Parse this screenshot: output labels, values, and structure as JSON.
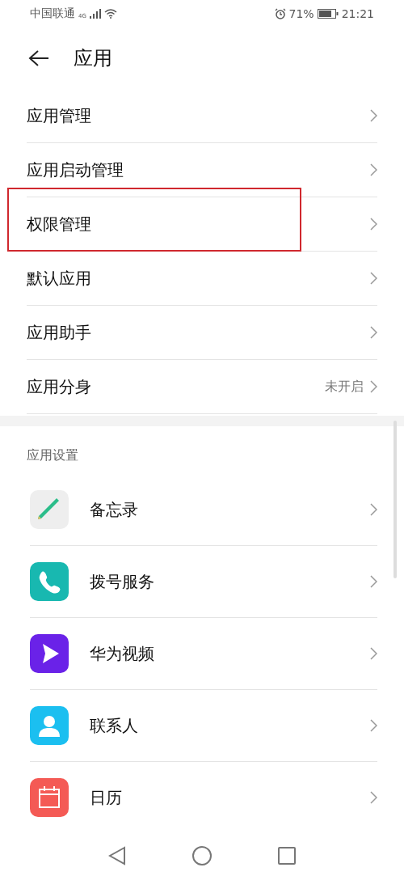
{
  "status_bar": {
    "carrier": "中国联通",
    "network": "4G",
    "battery_percent": "71%",
    "time": "21:21"
  },
  "header": {
    "title": "应用"
  },
  "menu_items": [
    {
      "label": "应用管理",
      "highlighted": false
    },
    {
      "label": "应用启动管理",
      "highlighted": false
    },
    {
      "label": "权限管理",
      "highlighted": true
    },
    {
      "label": "默认应用",
      "highlighted": false
    },
    {
      "label": "应用助手",
      "highlighted": false
    },
    {
      "label": "应用分身",
      "value": "未开启",
      "highlighted": false
    }
  ],
  "section": {
    "title": "应用设置"
  },
  "apps": [
    {
      "name": "备忘录",
      "kind": "notes"
    },
    {
      "name": "拨号服务",
      "kind": "phone"
    },
    {
      "name": "华为视频",
      "kind": "video"
    },
    {
      "name": "联系人",
      "kind": "contacts"
    },
    {
      "name": "日历",
      "kind": "calendar"
    }
  ]
}
